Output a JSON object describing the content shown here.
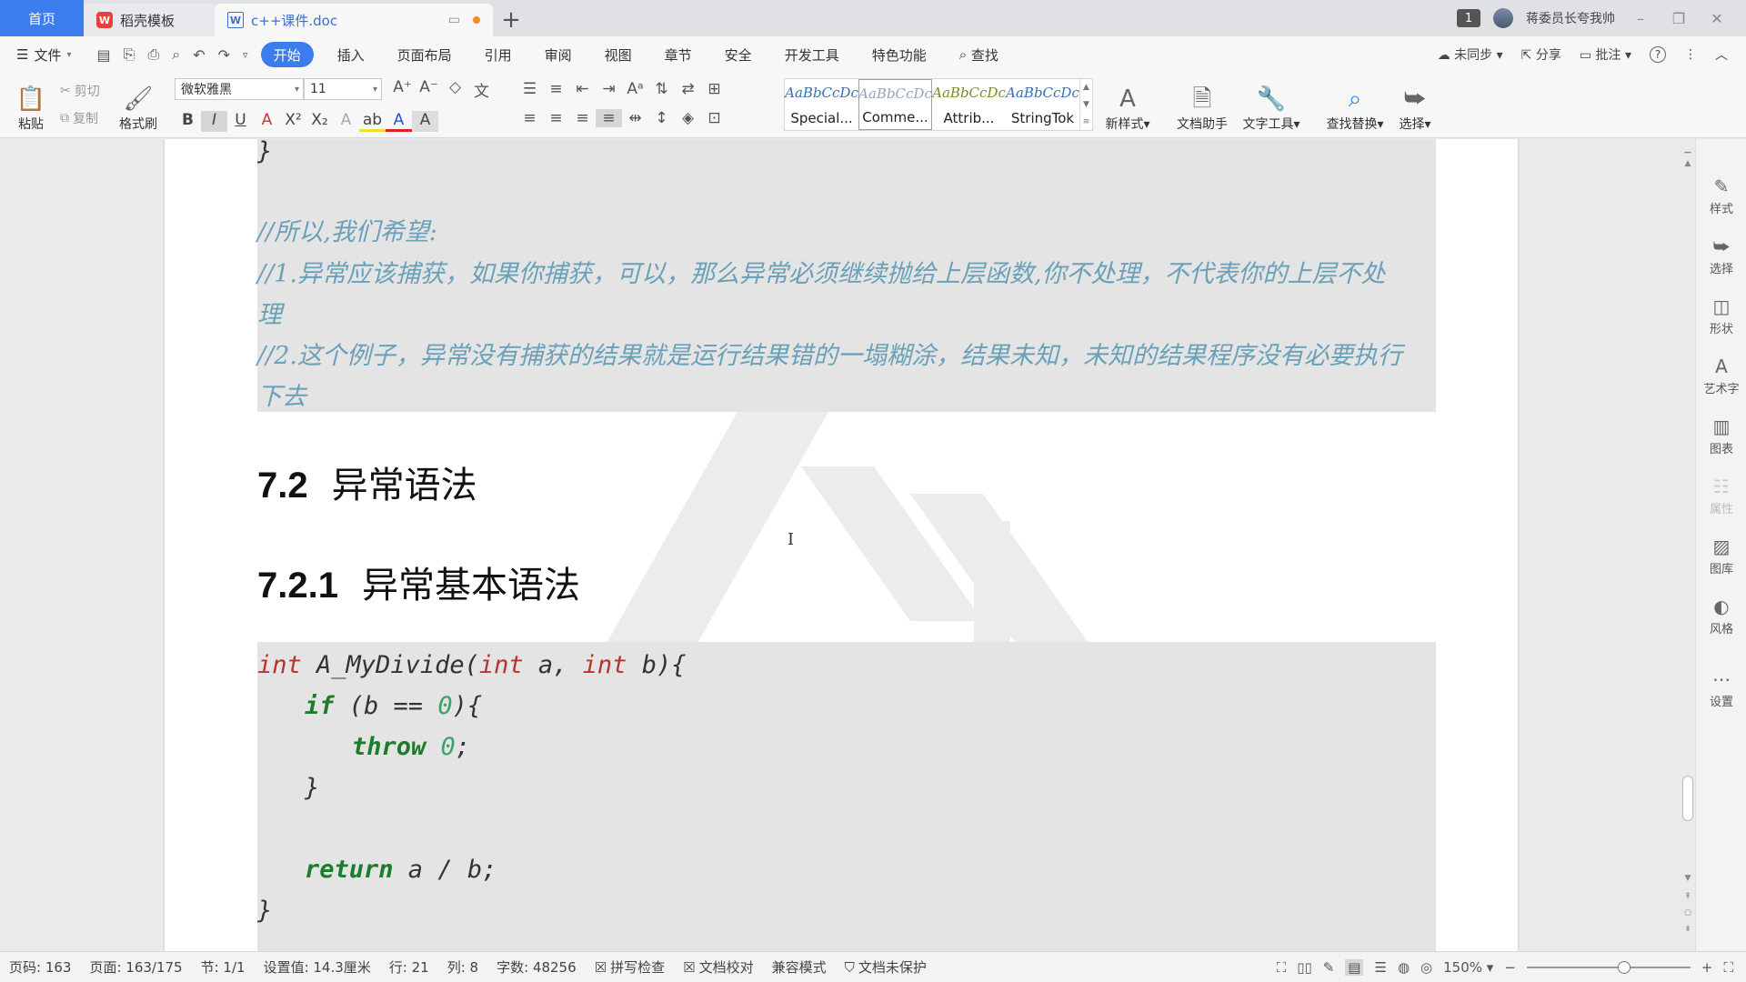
{
  "tabs": {
    "home": "首页",
    "template": "稻壳模板",
    "doc": "c++课件.doc",
    "new_tab": "+"
  },
  "titlebar": {
    "badge": "1",
    "user": "蒋委员长夸我帅"
  },
  "menubar": {
    "file": "文件",
    "items": [
      "开始",
      "插入",
      "页面布局",
      "引用",
      "审阅",
      "视图",
      "章节",
      "安全",
      "开发工具",
      "特色功能"
    ],
    "search": "查找",
    "right": {
      "sync": "未同步",
      "share": "分享",
      "comment": "批注",
      "help": "?"
    }
  },
  "ribbon": {
    "paste": "粘贴",
    "cut": "剪切",
    "copy": "复制",
    "format_painter": "格式刷",
    "font_name": "微软雅黑",
    "font_size": "11",
    "styles": [
      {
        "preview": "AaBbCcDc",
        "name": "Special..."
      },
      {
        "preview": "AaBbCcDc",
        "name": "Comme..."
      },
      {
        "preview": "AaBbCcDc",
        "name": "Attrib..."
      },
      {
        "preview": "AaBbCcDc",
        "name": "StringTok"
      }
    ],
    "new_style": "新样式",
    "doc_assistant": "文档助手",
    "text_tools": "文字工具",
    "find_replace": "查找替换",
    "select": "选择"
  },
  "document": {
    "brace_top": "}",
    "comments": [
      "//所以,我们希望:",
      "//1.异常应该捕获，如果你捕获，可以，那么异常必须继续抛给上层函数,你不处理，不代表你的上层不处",
      "理",
      "//2.这个例子，异常没有捕获的结果就是运行结果错的一塌糊涂，结果未知，未知的结果程序没有必要执行",
      "下去"
    ],
    "h72_num": "7.2",
    "h72_text": "异常语法",
    "h721_num": "7.2.1",
    "h721_text": "异常基本语法",
    "code": {
      "l1_kw1": "int",
      "l1_a": " A_MyDivide(",
      "l1_kw2": "int",
      "l1_b": " a, ",
      "l1_kw3": "int",
      "l1_c": " b){",
      "l2_kw": "if",
      "l2_a": " (b == ",
      "l2_num": "0",
      "l2_b": "){",
      "l3_kw": "throw",
      "l3_num": " 0",
      "l3_end": ";",
      "l4": "}",
      "l5_kw": "return",
      "l5_rest": " a / b;",
      "l6": "}"
    }
  },
  "rightpanel": [
    "样式",
    "选择",
    "形状",
    "艺术字",
    "图表",
    "属性",
    "图库",
    "风格",
    "设置"
  ],
  "statusbar": {
    "page_code": "页码: 163",
    "page": "页面: 163/175",
    "section": "节: 1/1",
    "setting": "设置值: 14.3厘米",
    "row": "行: 21",
    "col": "列: 8",
    "words": "字数: 48256",
    "spell": "拼写检查",
    "proof": "文档校对",
    "compat": "兼容模式",
    "protect": "文档未保护",
    "zoom": "150%"
  }
}
